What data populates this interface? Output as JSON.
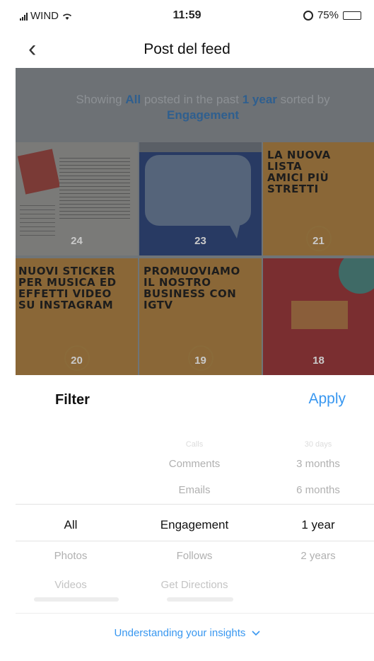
{
  "status_bar": {
    "carrier": "WIND",
    "time": "11:59",
    "battery": "75%",
    "battery_level": 0.75,
    "icons": [
      "signal-icon",
      "wifi-icon",
      "alarm-icon",
      "battery-icon"
    ]
  },
  "nav": {
    "back_icon": "chevron-left-icon",
    "title": "Post del feed"
  },
  "feed": {
    "caption": {
      "prefix": "Showing ",
      "type": "All",
      "middle": " posted in the past ",
      "range": "1 year",
      "suffix": " sorted by ",
      "metric": "Engagement"
    },
    "tiles": [
      {
        "count": "24",
        "lines": []
      },
      {
        "count": "23",
        "lines": []
      },
      {
        "count": "21",
        "lines": [
          "LA NUOVA",
          "LISTA",
          "AMICI PIÙ",
          "STRETTI"
        ]
      },
      {
        "count": "20",
        "lines": [
          "NUOVI STICKER",
          "PER MUSICA ED",
          "EFFETTI VIDEO",
          "SU INSTAGRAM"
        ]
      },
      {
        "count": "19",
        "lines": [
          "PROMUOVIAMO",
          "IL NOSTRO",
          "BUSINESS CON",
          "IGTV"
        ]
      },
      {
        "count": "18",
        "lines": []
      }
    ]
  },
  "filter": {
    "title": "Filter",
    "apply_label": "Apply",
    "columns": {
      "type": [
        "All",
        "Photos",
        "Videos"
      ],
      "metric": [
        "Calls",
        "Comments",
        "Emails",
        "Engagement",
        "Follows",
        "Get Directions"
      ],
      "range": [
        "30 days",
        "3 months",
        "6 months",
        "1 year",
        "2 years"
      ]
    },
    "selected": {
      "type": "All",
      "metric": "Engagement",
      "range": "1 year"
    }
  },
  "insights": {
    "link_label": "Understanding your insights",
    "chevron_icon": "chevron-down-icon"
  },
  "colors": {
    "accent": "#3897f0",
    "overlay": "#6f7478"
  }
}
